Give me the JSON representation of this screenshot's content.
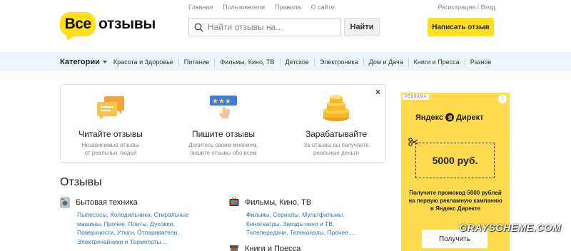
{
  "header": {
    "logo_part1": "Все",
    "logo_part2": "отзывы",
    "topnav": [
      "Главная",
      "Пользователи",
      "Правила",
      "О сайте"
    ],
    "auth": "Регистрация / Вход",
    "search_placeholder": "Найти отзывы на...",
    "find_button": "Найти",
    "write_button": "Написать отзыв"
  },
  "categories": {
    "label": "Категории",
    "items": [
      "Красота и Здоровье",
      "Питание",
      "Фильмы, Кино, ТВ",
      "Детское",
      "Электроника",
      "Дом и Дача",
      "Книги и Пресса",
      "Разное"
    ]
  },
  "intro": {
    "close": "×",
    "features": [
      {
        "title": "Читайте отзывы",
        "line1": "Независимые отзывы",
        "line2": "от реальных людей",
        "icon": "chat-bubbles-icon"
      },
      {
        "title": "Пишите отзывы",
        "line1": "Делитесь своим мнением,",
        "line2": "пишите отзывы обо всем",
        "icon": "rating-stars-icon"
      },
      {
        "title": "Зарабатывайте",
        "line1": "За отзывы вы получаете",
        "line2": "реальные деньги",
        "icon": "coins-icon"
      }
    ]
  },
  "reviews": {
    "title": "Отзывы",
    "cat1": {
      "name": "Бытовая техника",
      "lines": [
        "Пылесосы, Холодильники, Стиральные",
        "машины, Прочее, Плиты, Духовки,",
        "Поверхности, Утюги, Отпариватели,",
        "Электрочайники и Термопоты ..."
      ]
    },
    "cat2": {
      "name": "Фильмы, Кино, ТВ",
      "lines": [
        "Фильмы, Сериалы, Мультфильмы,",
        "Кинотеатры, Звезды кино и ТВ,",
        "Телепередачи, Телеканалы, Прочее ..."
      ]
    },
    "cat3": {
      "name": "Книги и Пресса"
    }
  },
  "ad": {
    "label": "РЕКЛАМА",
    "menu": "⋮",
    "brand_left": "Яндекс",
    "brand_right": "Директ",
    "amount": "5000 руб.",
    "promo": "Получите промокод 5000 рублей на первую рекламную кампанию в Яндекс Директе",
    "button": "Получить",
    "colors": {
      "background": "#ffdb4d"
    }
  },
  "watermark": "GRAYSCHEME.COM",
  "colors": {
    "accent": "#ffe01b",
    "link": "#2a7ab8",
    "catbar": "#eef5fb"
  }
}
